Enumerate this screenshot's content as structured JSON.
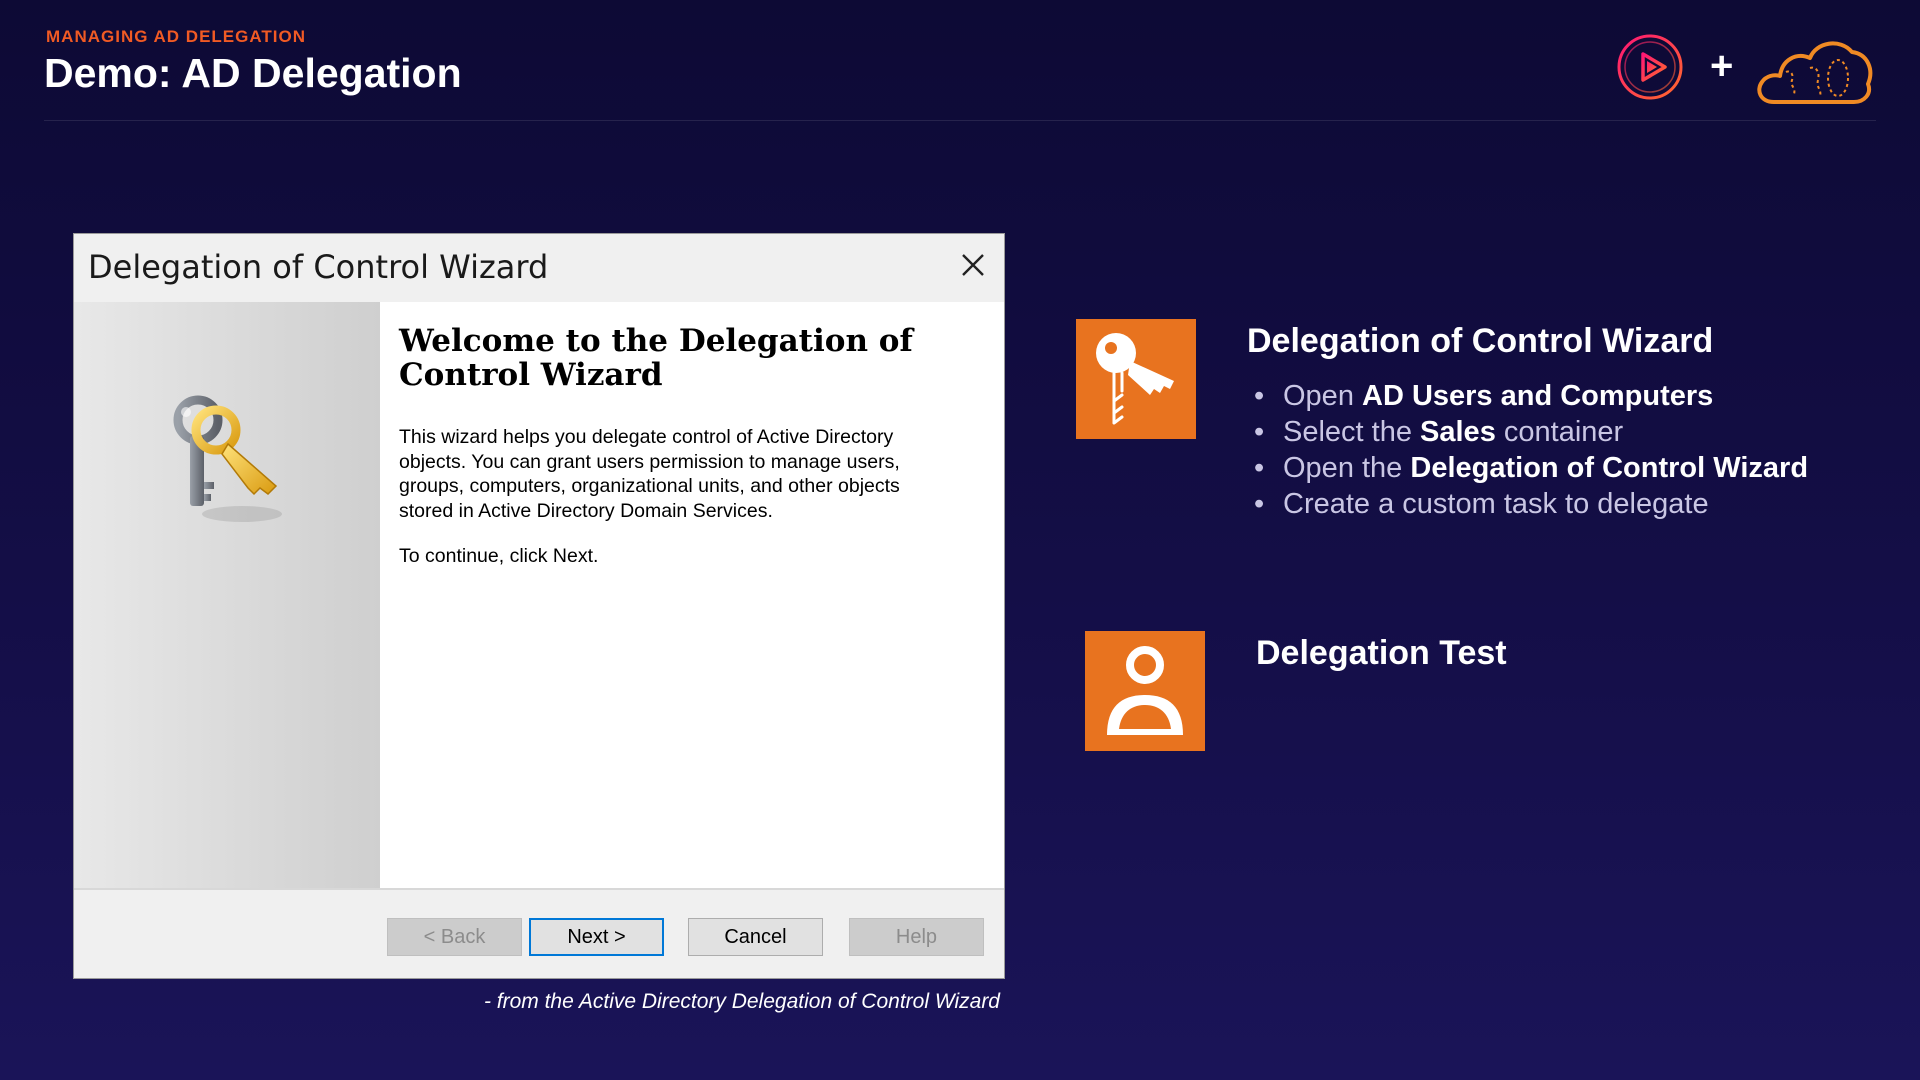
{
  "header": {
    "eyebrow": "MANAGING AD DELEGATION",
    "title": "Demo: AD Delegation",
    "plus": "+"
  },
  "dialog": {
    "title": "Delegation of Control Wizard",
    "heading": "Welcome to the Delegation of Control Wizard",
    "description": "This wizard helps you delegate control of Active Directory objects. You can grant users permission to manage users, groups, computers, organizational units, and other objects stored in Active Directory Domain Services.",
    "continue_text": "To continue, click Next.",
    "buttons": {
      "back": "< Back",
      "next": "Next >",
      "cancel": "Cancel",
      "help": "Help"
    }
  },
  "caption": "- from the Active Directory Delegation of Control Wizard",
  "section1": {
    "title": "Delegation of Control Wizard",
    "bullets": [
      {
        "pre": "Open ",
        "bold": "AD Users and Computers",
        "post": ""
      },
      {
        "pre": "Select the ",
        "bold": "Sales",
        "post": " container"
      },
      {
        "pre": "Open the ",
        "bold": "Delegation of Control Wizard",
        "post": ""
      },
      {
        "pre": "Create a custom task to delegate",
        "bold": "",
        "post": ""
      }
    ]
  },
  "section2": {
    "title": "Delegation Test"
  },
  "icons": {
    "tile_1": "key-icon",
    "tile_2": "user-icon",
    "dialog_art": "keys-icon",
    "close": "close-icon"
  },
  "colors": {
    "background": "#110c3f",
    "accent_orange": "#e8731f",
    "eyebrow": "#f15a24",
    "brand_pink": "#e2336b"
  }
}
